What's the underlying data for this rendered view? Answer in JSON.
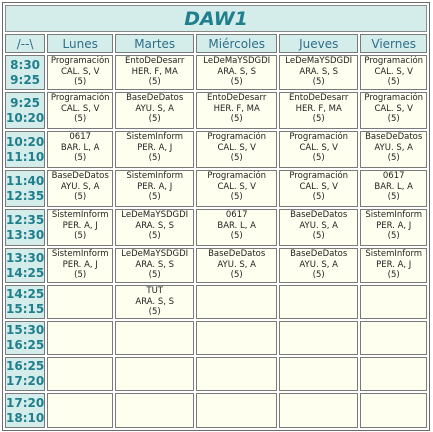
{
  "title": "DAW1",
  "corner_label": "/--\\",
  "days": [
    "Lunes",
    "Martes",
    "Miércoles",
    "Jueves",
    "Viernes"
  ],
  "rows": [
    {
      "start": "8:30",
      "end": "9:25",
      "cells": [
        {
          "subject": "Programación",
          "teacher": "CAL. S, V",
          "count": "(5)"
        },
        {
          "subject": "EntoDeDesarr",
          "teacher": "HER. F, MA",
          "count": "(5)"
        },
        {
          "subject": "LeDeMaYSDGDI",
          "teacher": "ARA. S, S",
          "count": "(5)"
        },
        {
          "subject": "LeDeMaYSDGDI",
          "teacher": "ARA. S, S",
          "count": "(5)"
        },
        {
          "subject": "Programación",
          "teacher": "CAL. S, V",
          "count": "(5)"
        }
      ]
    },
    {
      "start": "9:25",
      "end": "10:20",
      "cells": [
        {
          "subject": "Programación",
          "teacher": "CAL. S, V",
          "count": "(5)"
        },
        {
          "subject": "BaseDeDatos",
          "teacher": "AYU. S, A",
          "count": "(5)"
        },
        {
          "subject": "EntoDeDesarr",
          "teacher": "HER. F, MA",
          "count": "(5)"
        },
        {
          "subject": "EntoDeDesarr",
          "teacher": "HER. F, MA",
          "count": "(5)"
        },
        {
          "subject": "Programación",
          "teacher": "CAL. S, V",
          "count": "(5)"
        }
      ]
    },
    {
      "start": "10:20",
      "end": "11:10",
      "cells": [
        {
          "subject": "0617",
          "teacher": "BAR. L, A",
          "count": "(5)"
        },
        {
          "subject": "SistemInform",
          "teacher": "PER. A, J",
          "count": "(5)"
        },
        {
          "subject": "Programación",
          "teacher": "CAL. S, V",
          "count": "(5)"
        },
        {
          "subject": "Programación",
          "teacher": "CAL. S, V",
          "count": "(5)"
        },
        {
          "subject": "BaseDeDatos",
          "teacher": "AYU. S, A",
          "count": "(5)"
        }
      ]
    },
    {
      "start": "11:40",
      "end": "12:35",
      "cells": [
        {
          "subject": "BaseDeDatos",
          "teacher": "AYU. S, A",
          "count": "(5)"
        },
        {
          "subject": "SistemInform",
          "teacher": "PER. A, J",
          "count": "(5)"
        },
        {
          "subject": "Programación",
          "teacher": "CAL. S, V",
          "count": "(5)"
        },
        {
          "subject": "Programación",
          "teacher": "CAL. S, V",
          "count": "(5)"
        },
        {
          "subject": "0617",
          "teacher": "BAR. L, A",
          "count": "(5)"
        }
      ]
    },
    {
      "start": "12:35",
      "end": "13:30",
      "cells": [
        {
          "subject": "SistemInform",
          "teacher": "PER. A, J",
          "count": "(5)"
        },
        {
          "subject": "LeDeMaYSDGDI",
          "teacher": "ARA. S, S",
          "count": "(5)"
        },
        {
          "subject": "0617",
          "teacher": "BAR. L, A",
          "count": "(5)"
        },
        {
          "subject": "BaseDeDatos",
          "teacher": "AYU. S, A",
          "count": "(5)"
        },
        {
          "subject": "SistemInform",
          "teacher": "PER. A, J",
          "count": "(5)"
        }
      ]
    },
    {
      "start": "13:30",
      "end": "14:25",
      "cells": [
        {
          "subject": "SistemInform",
          "teacher": "PER. A, J",
          "count": "(5)"
        },
        {
          "subject": "LeDeMaYSDGDI",
          "teacher": "ARA. S, S",
          "count": "(5)"
        },
        {
          "subject": "BaseDeDatos",
          "teacher": "AYU. S, A",
          "count": "(5)"
        },
        {
          "subject": "BaseDeDatos",
          "teacher": "AYU. S, A",
          "count": "(5)"
        },
        {
          "subject": "SistemInform",
          "teacher": "PER. A, J",
          "count": "(5)"
        }
      ]
    },
    {
      "start": "14:25",
      "end": "15:15",
      "cells": [
        null,
        {
          "subject": "TUT",
          "teacher": "ARA. S, S",
          "count": "(5)"
        },
        null,
        null,
        null
      ]
    },
    {
      "start": "15:30",
      "end": "16:25",
      "cells": [
        null,
        null,
        null,
        null,
        null
      ]
    },
    {
      "start": "16:25",
      "end": "17:20",
      "cells": [
        null,
        null,
        null,
        null,
        null
      ]
    },
    {
      "start": "17:20",
      "end": "18:10",
      "cells": [
        null,
        null,
        null,
        null,
        null
      ]
    }
  ]
}
